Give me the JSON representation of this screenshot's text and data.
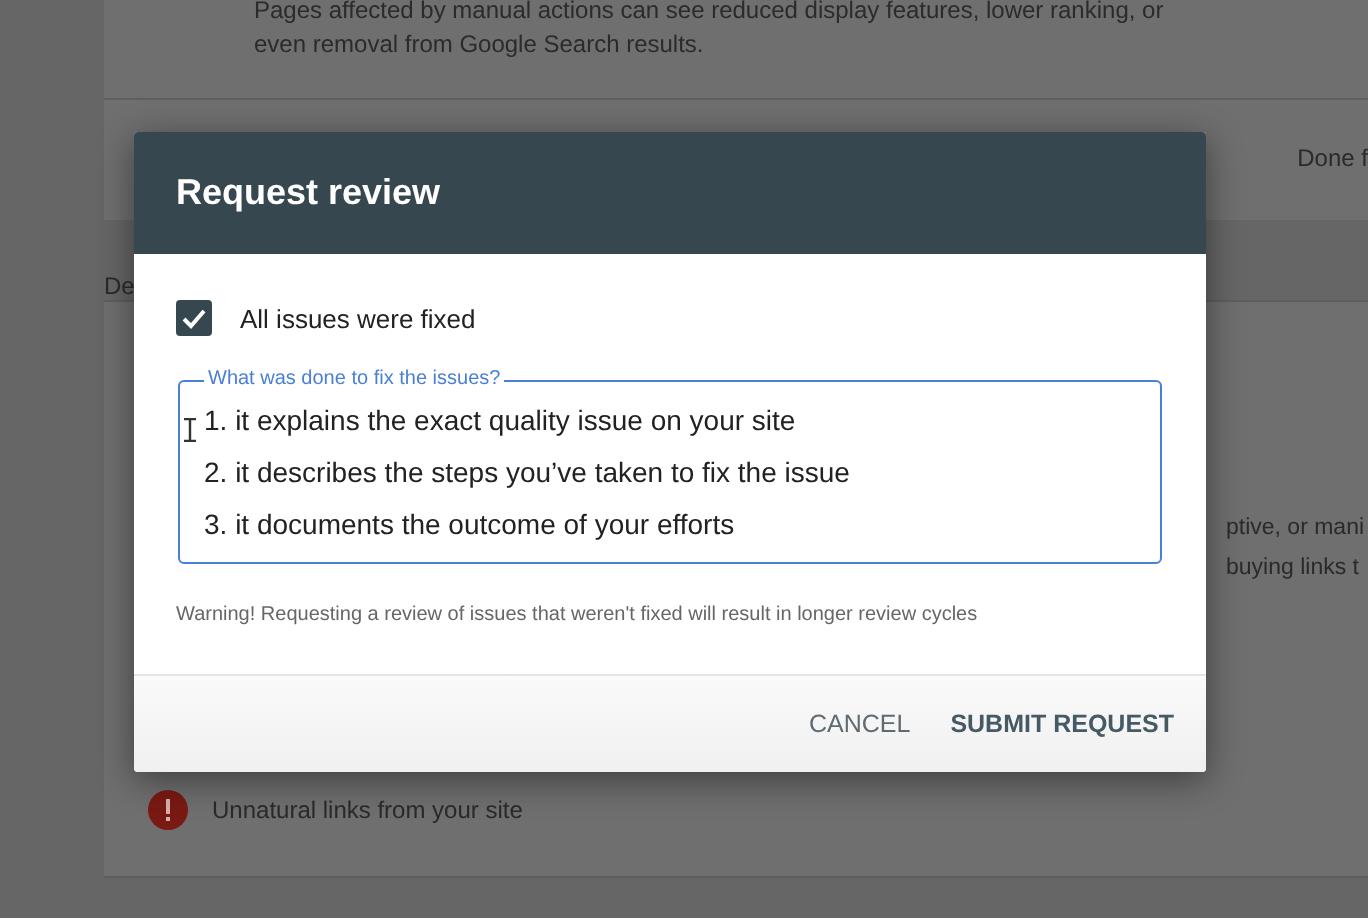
{
  "background": {
    "intro_lines": [
      "Pages affected by manual actions can see reduced display features, lower ranking, or",
      "even removal from Google Search results."
    ],
    "status_text": "Done f",
    "section_text": "De",
    "issue_fragments": [
      "ptive, or mani",
      "buying links t"
    ],
    "issue": {
      "label": "Unnatural links from your site"
    }
  },
  "dialog": {
    "title": "Request review",
    "checkbox": {
      "label": "All issues were fixed",
      "checked": true
    },
    "field": {
      "label": "What was done to fix the issues?",
      "value_lines": [
        "1. it explains the exact quality issue on your site",
        "2. it describes the steps you’ve taken to fix the issue",
        "3. it documents the outcome of your efforts"
      ]
    },
    "warning": "Warning! Requesting a review of issues that weren't fixed will result in longer review cycles",
    "buttons": [
      "CANCEL",
      "SUBMIT REQUEST"
    ]
  }
}
